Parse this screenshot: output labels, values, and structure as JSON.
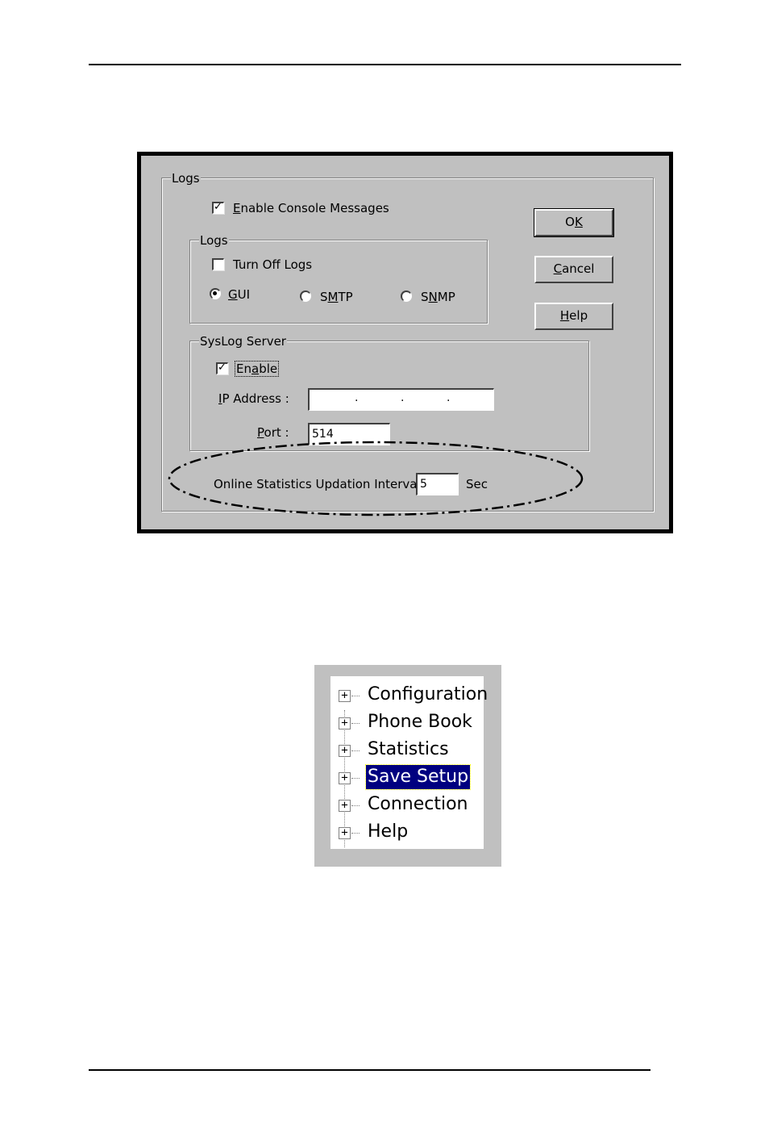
{
  "dialog": {
    "outer_group": "Logs",
    "enable_console": {
      "label_prefix": "",
      "accel": "E",
      "label_rest": "nable Console Messages",
      "checked": true
    },
    "logs_group": {
      "title": "Logs",
      "turn_off": {
        "label": "Turn Off Logs",
        "checked": false
      },
      "radios": [
        {
          "accel": "G",
          "rest": "UI",
          "pre": "",
          "selected": true
        },
        {
          "pre": "S",
          "accel": "M",
          "rest": "TP",
          "selected": false
        },
        {
          "pre": "S",
          "accel": "N",
          "rest": "MP",
          "selected": false
        }
      ]
    },
    "syslog_group": {
      "title": "SysLog Server",
      "enable": {
        "pre": "En",
        "accel": "a",
        "rest": "ble",
        "checked": true
      },
      "ip_label_accel": "I",
      "ip_label_rest": "P Address :",
      "ip_dots": [
        ".",
        ".",
        "."
      ],
      "port_label_accel": "P",
      "port_label_rest": "ort :",
      "port_value": "514"
    },
    "interval": {
      "label": "Online Statistics Updation Interval",
      "value": "5",
      "unit": "Sec"
    },
    "buttons": {
      "ok": {
        "pre": "O",
        "accel": "K"
      },
      "cancel": {
        "accel": "C",
        "rest": "ancel"
      },
      "help": {
        "accel": "H",
        "rest": "elp"
      }
    }
  },
  "tree": {
    "items": [
      {
        "label": "Configuration",
        "selected": false
      },
      {
        "label": "Phone Book",
        "selected": false
      },
      {
        "label": "Statistics",
        "selected": false
      },
      {
        "label": "Save Setup",
        "selected": true
      },
      {
        "label": "Connection",
        "selected": false
      },
      {
        "label": "Help",
        "selected": false
      }
    ],
    "expander_glyph": "+"
  },
  "icons": {
    "checkmark": "✓"
  }
}
